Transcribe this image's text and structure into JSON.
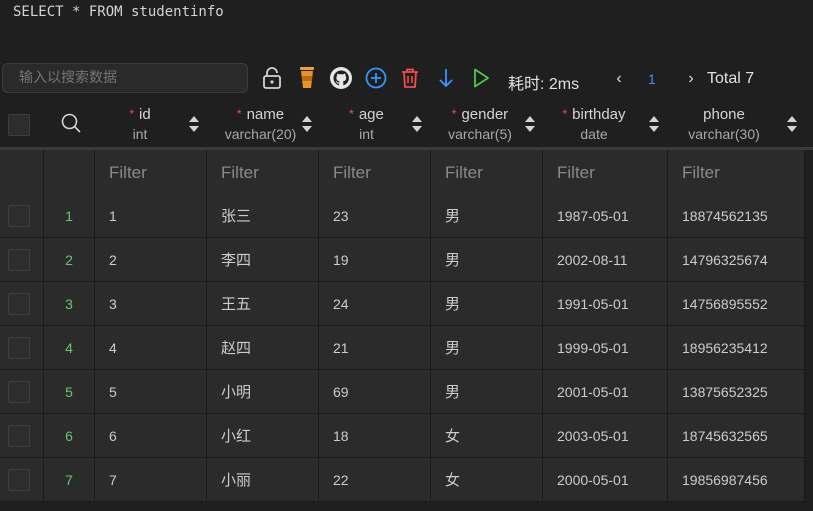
{
  "query": "SELECT * FROM studentinfo",
  "toolbar": {
    "search_placeholder": "输入以搜索数据",
    "timing": "耗时: 2ms",
    "page": "1",
    "total": "Total 7",
    "prev_glyph": "‹",
    "next_glyph": "›"
  },
  "colors": {
    "accent_blue": "#3794ff",
    "delete_red": "#f14c4c",
    "run_green": "#4ec94e",
    "row_number_green": "#6fc36f"
  },
  "columns": [
    {
      "name": "id",
      "type": "int",
      "required": true
    },
    {
      "name": "name",
      "type": "varchar(20)",
      "required": true
    },
    {
      "name": "age",
      "type": "int",
      "required": true
    },
    {
      "name": "gender",
      "type": "varchar(5)",
      "required": true
    },
    {
      "name": "birthday",
      "type": "date",
      "required": true
    },
    {
      "name": "phone",
      "type": "varchar(30)",
      "required": false
    }
  ],
  "required_mark": "*",
  "filter_label": "Filter",
  "rows": [
    {
      "n": "1",
      "cells": [
        "1",
        "张三",
        "23",
        "男",
        "1987-05-01",
        "18874562135"
      ]
    },
    {
      "n": "2",
      "cells": [
        "2",
        "李四",
        "19",
        "男",
        "2002-08-11",
        "14796325674"
      ]
    },
    {
      "n": "3",
      "cells": [
        "3",
        "王五",
        "24",
        "男",
        "1991-05-01",
        "14756895552"
      ]
    },
    {
      "n": "4",
      "cells": [
        "4",
        "赵四",
        "21",
        "男",
        "1999-05-01",
        "18956235412"
      ]
    },
    {
      "n": "5",
      "cells": [
        "5",
        "小明",
        "69",
        "男",
        "2001-05-01",
        "13875652325"
      ]
    },
    {
      "n": "6",
      "cells": [
        "6",
        "小红",
        "18",
        "女",
        "2003-05-01",
        "18745632565"
      ]
    },
    {
      "n": "7",
      "cells": [
        "7",
        "小丽",
        "22",
        "女",
        "2000-05-01",
        "19856987456"
      ]
    }
  ],
  "icons": {
    "unlock": "unlock-icon",
    "cup": "cup-icon",
    "github": "github-icon",
    "add": "add-icon",
    "delete": "trash-icon",
    "export": "arrow-down-icon",
    "run": "play-icon"
  }
}
